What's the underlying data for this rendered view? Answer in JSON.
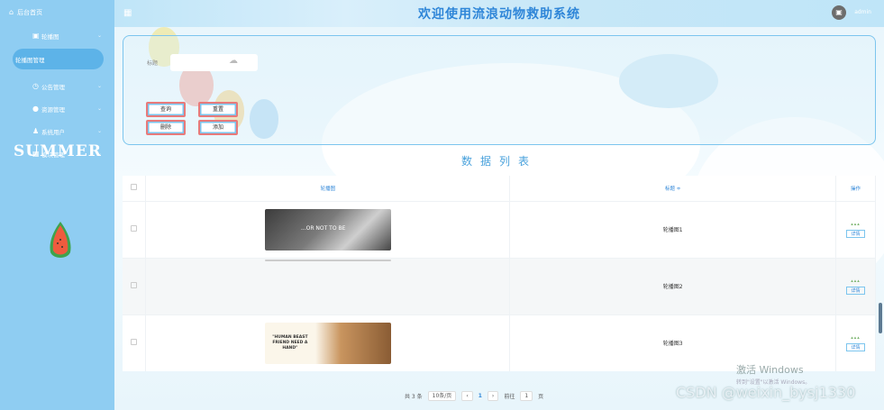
{
  "app": {
    "home_label": "后台首页",
    "title": "欢迎使用流浪动物救助系统",
    "username": "admin"
  },
  "sidebar": {
    "items": [
      {
        "label": "轮播图"
      },
      {
        "label": "轮播图管理"
      },
      {
        "label": "公告管理"
      },
      {
        "label": "资源管理"
      },
      {
        "label": "系统用户"
      },
      {
        "label": "模块管理"
      }
    ],
    "decor_text": "SUMMER"
  },
  "search": {
    "label": "标题",
    "placeholder": "",
    "buttons": {
      "query": "查询",
      "reset": "重置",
      "delete": "删除",
      "add": "添加"
    }
  },
  "list": {
    "title": "数据列表",
    "columns": [
      "轮播图",
      "标题 ≑",
      "操作"
    ],
    "rows": [
      {
        "image_text": "...OR NOT TO BE",
        "title": "轮播图1"
      },
      {
        "image_text": "",
        "title": "轮播图2"
      },
      {
        "image_text": "\"HUMAN BEAST FRIEND NEED A HAND\"",
        "title": "轮播图3"
      }
    ],
    "op_label": "详情"
  },
  "pager": {
    "total": "共 3 条",
    "page_size": "10条/页",
    "current": "1",
    "goto_label": "前往",
    "goto_value": "1",
    "page_unit": "页"
  },
  "overlay": {
    "win_title": "激活 Windows",
    "win_sub": "转到\"设置\"以激活 Windows。",
    "csdn": "CSDN @weixin_bysj1330"
  }
}
